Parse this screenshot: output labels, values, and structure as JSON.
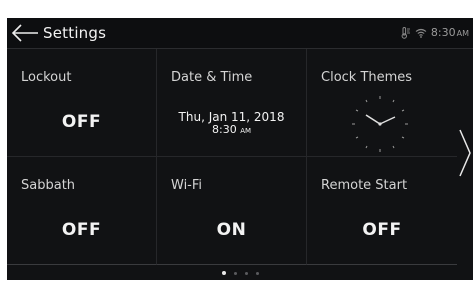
{
  "header": {
    "title": "Settings",
    "time": "8:30",
    "ampm": "AM",
    "back_icon": "arrow-left-icon",
    "status_icons": [
      "temperature-probe-icon",
      "wifi-icon"
    ]
  },
  "tiles": [
    {
      "label": "Lockout",
      "value": "OFF"
    },
    {
      "label": "Date & Time",
      "date": "Thu, Jan 11, 2018",
      "time": "8:30",
      "ampm": "AM"
    },
    {
      "label": "Clock Themes",
      "icon": "analog-clock-icon"
    },
    {
      "label": "Sabbath",
      "value": "OFF"
    },
    {
      "label": "Wi-Fi",
      "value": "ON"
    },
    {
      "label": "Remote Start",
      "value": "OFF"
    }
  ],
  "navigation": {
    "next_icon": "chevron-right-icon",
    "page_count": 4,
    "current_page": 1
  },
  "colors": {
    "background": "#111214",
    "header": "#0d0e10",
    "divider": "#26272a",
    "text": "#f3f3f3",
    "status": "#8a8a8a"
  }
}
